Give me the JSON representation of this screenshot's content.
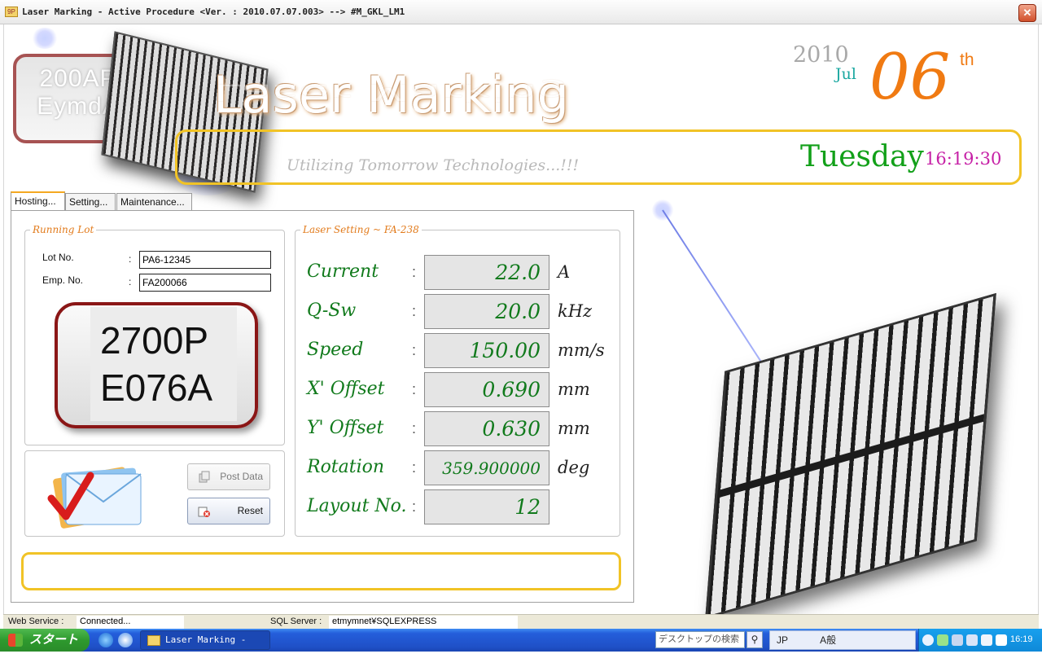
{
  "window": {
    "title": "Laser Marking - Active Procedure <Ver. : 2010.07.07.003> --> #M_GKL_LM1",
    "app_icon_text": "9P",
    "close_glyph": "✕"
  },
  "header": {
    "logo_line1": "200AP",
    "logo_line2": "EymdA",
    "title": "Laser Marking",
    "tagline": "Utilizing Tomorrow Technologies...!!!",
    "year": "2010",
    "month": "Jul",
    "day": "06",
    "day_suffix": "th",
    "weekday": "Tuesday",
    "time": "16:19:30"
  },
  "tabs": [
    {
      "label": "Hosting...",
      "active": true
    },
    {
      "label": "Setting...",
      "active": false
    },
    {
      "label": "Maintenance...",
      "active": false
    }
  ],
  "running_lot": {
    "legend": "Running Lot",
    "lot_no_label": "Lot No.",
    "lot_no_value": "PA6-12345",
    "emp_no_label": "Emp. No.",
    "emp_no_value": "FA200066",
    "colon": ":",
    "marking_line1": "2700P",
    "marking_line2": "E076A"
  },
  "actions": {
    "post_data_label": "Post Data",
    "reset_label": "Reset"
  },
  "laser_setting": {
    "legend": "Laser Setting ~ FA-238",
    "colon": ":",
    "rows": [
      {
        "label": "Current",
        "value": "22.0",
        "unit": "A"
      },
      {
        "label": "Q-Sw",
        "value": "20.0",
        "unit": "kHz"
      },
      {
        "label": "Speed",
        "value": "150.00",
        "unit": "mm/s"
      },
      {
        "label": "X' Offset",
        "value": "0.690",
        "unit": "mm"
      },
      {
        "label": "Y' Offset",
        "value": "0.630",
        "unit": "mm"
      },
      {
        "label": "Rotation",
        "value": "359.900000",
        "unit": "deg"
      },
      {
        "label": "Layout No.",
        "value": "12",
        "unit": ""
      }
    ]
  },
  "status": {
    "web_service_label": "Web Service :",
    "web_service_value": "Connected...",
    "sql_server_label": "SQL Server :",
    "sql_server_value": "etmymnet¥SQLEXPRESS"
  },
  "taskbar": {
    "start_label": "スタート",
    "task_label": "Laser Marking - Acti...",
    "search_placeholder": "デスクトップの検索",
    "lang_label": "JP",
    "ime_label": "A般",
    "clock": "16:19"
  },
  "colors": {
    "accent_gold": "#f1c326",
    "title_green": "#117a1c",
    "legend_orange": "#e27b1c",
    "day_orange": "#f07a12",
    "time_magenta": "#c620a6"
  }
}
